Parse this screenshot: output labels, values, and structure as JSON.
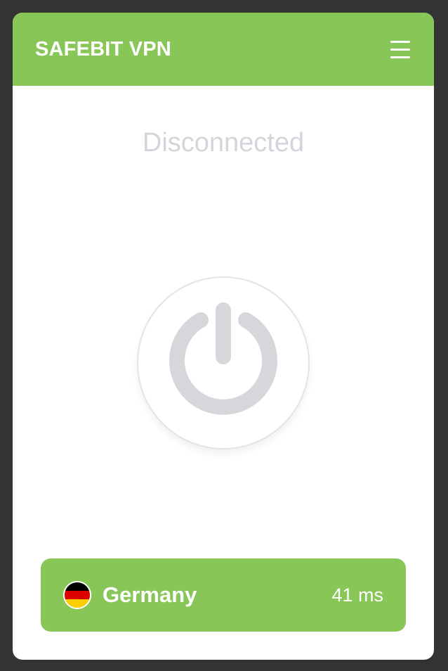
{
  "header": {
    "title": "SAFEBIT VPN",
    "menu_icon": "hamburger-menu-icon"
  },
  "status": {
    "text": "Disconnected"
  },
  "power_button": {
    "icon": "power-icon",
    "state": "disconnected"
  },
  "location": {
    "country": "Germany",
    "latency": "41 ms",
    "flag_icon": "germany-flag-icon"
  },
  "colors": {
    "accent": "#88c657",
    "background": "#333333",
    "panel": "#ffffff",
    "status_text": "#d2d5da",
    "power_icon": "#d5d7db"
  }
}
